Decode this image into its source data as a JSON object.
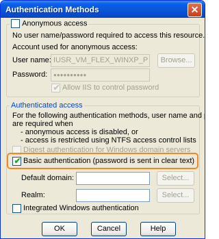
{
  "window": {
    "title": "Authentication Methods",
    "close_glyph": "✕"
  },
  "anonymous": {
    "checkbox_label": "Anonymous access",
    "checked": false,
    "description": "No user name/password required to access this resource.",
    "account_label": "Account used for anonymous access:",
    "username_label": "User name:",
    "username_value": "IUSR_VM_FLEX_WINXP_P",
    "browse_label": "Browse...",
    "password_label": "Password:",
    "password_value": "●●●●●●●●●●",
    "allow_iis_label": "Allow IIS to control password",
    "allow_iis_checked": true
  },
  "authenticated": {
    "group_label": "Authenticated access",
    "description_1": "For the following authentication methods, user name and password",
    "description_2": "are required when",
    "bullet_1": "- anonymous access is disabled, or",
    "bullet_2": "- access is restricted using NTFS access control lists",
    "digest_label": "Digest authentication for Windows domain servers",
    "digest_checked": false,
    "basic_label": "Basic authentication (password is sent in clear text)",
    "basic_checked": true,
    "default_domain_label": "Default domain:",
    "default_domain_value": "",
    "realm_label": "Realm:",
    "realm_value": "",
    "select_label": "Select...",
    "integrated_label": "Integrated Windows authentication",
    "integrated_checked": false
  },
  "buttons": {
    "ok": "OK",
    "cancel": "Cancel",
    "help": "Help"
  },
  "colors": {
    "highlight": "#f08a24",
    "title_bar": "#0a54d8",
    "face": "#ece9d8"
  }
}
